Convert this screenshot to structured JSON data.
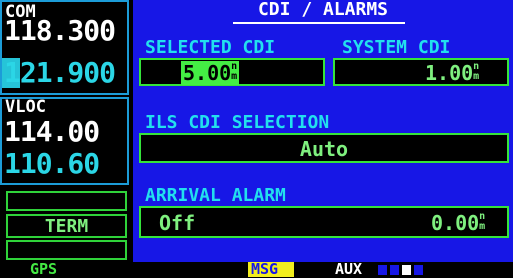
{
  "com": {
    "label": "COM",
    "active": "118.300",
    "standby": "121.900"
  },
  "vloc": {
    "label": "VLOC",
    "active": "114.00",
    "standby": "110.60"
  },
  "cdi_mode": "TERM",
  "page": {
    "title": "CDI / ALARMS",
    "selected_cdi": {
      "label": "SELECTED CDI",
      "value": "5.00",
      "unit_top": "n",
      "unit_bottom": "m"
    },
    "system_cdi": {
      "label": "SYSTEM CDI",
      "value": "1.00",
      "unit_top": "n",
      "unit_bottom": "m"
    },
    "ils_cdi": {
      "label": "ILS CDI SELECTION",
      "value": "Auto"
    },
    "arrival_alarm": {
      "label": "ARRIVAL ALARM",
      "state": "Off",
      "value": "0.00",
      "unit_top": "n",
      "unit_bottom": "m"
    }
  },
  "status_bar": {
    "mode": "GPS",
    "msg": "MSG",
    "page_group": "AUX"
  }
}
